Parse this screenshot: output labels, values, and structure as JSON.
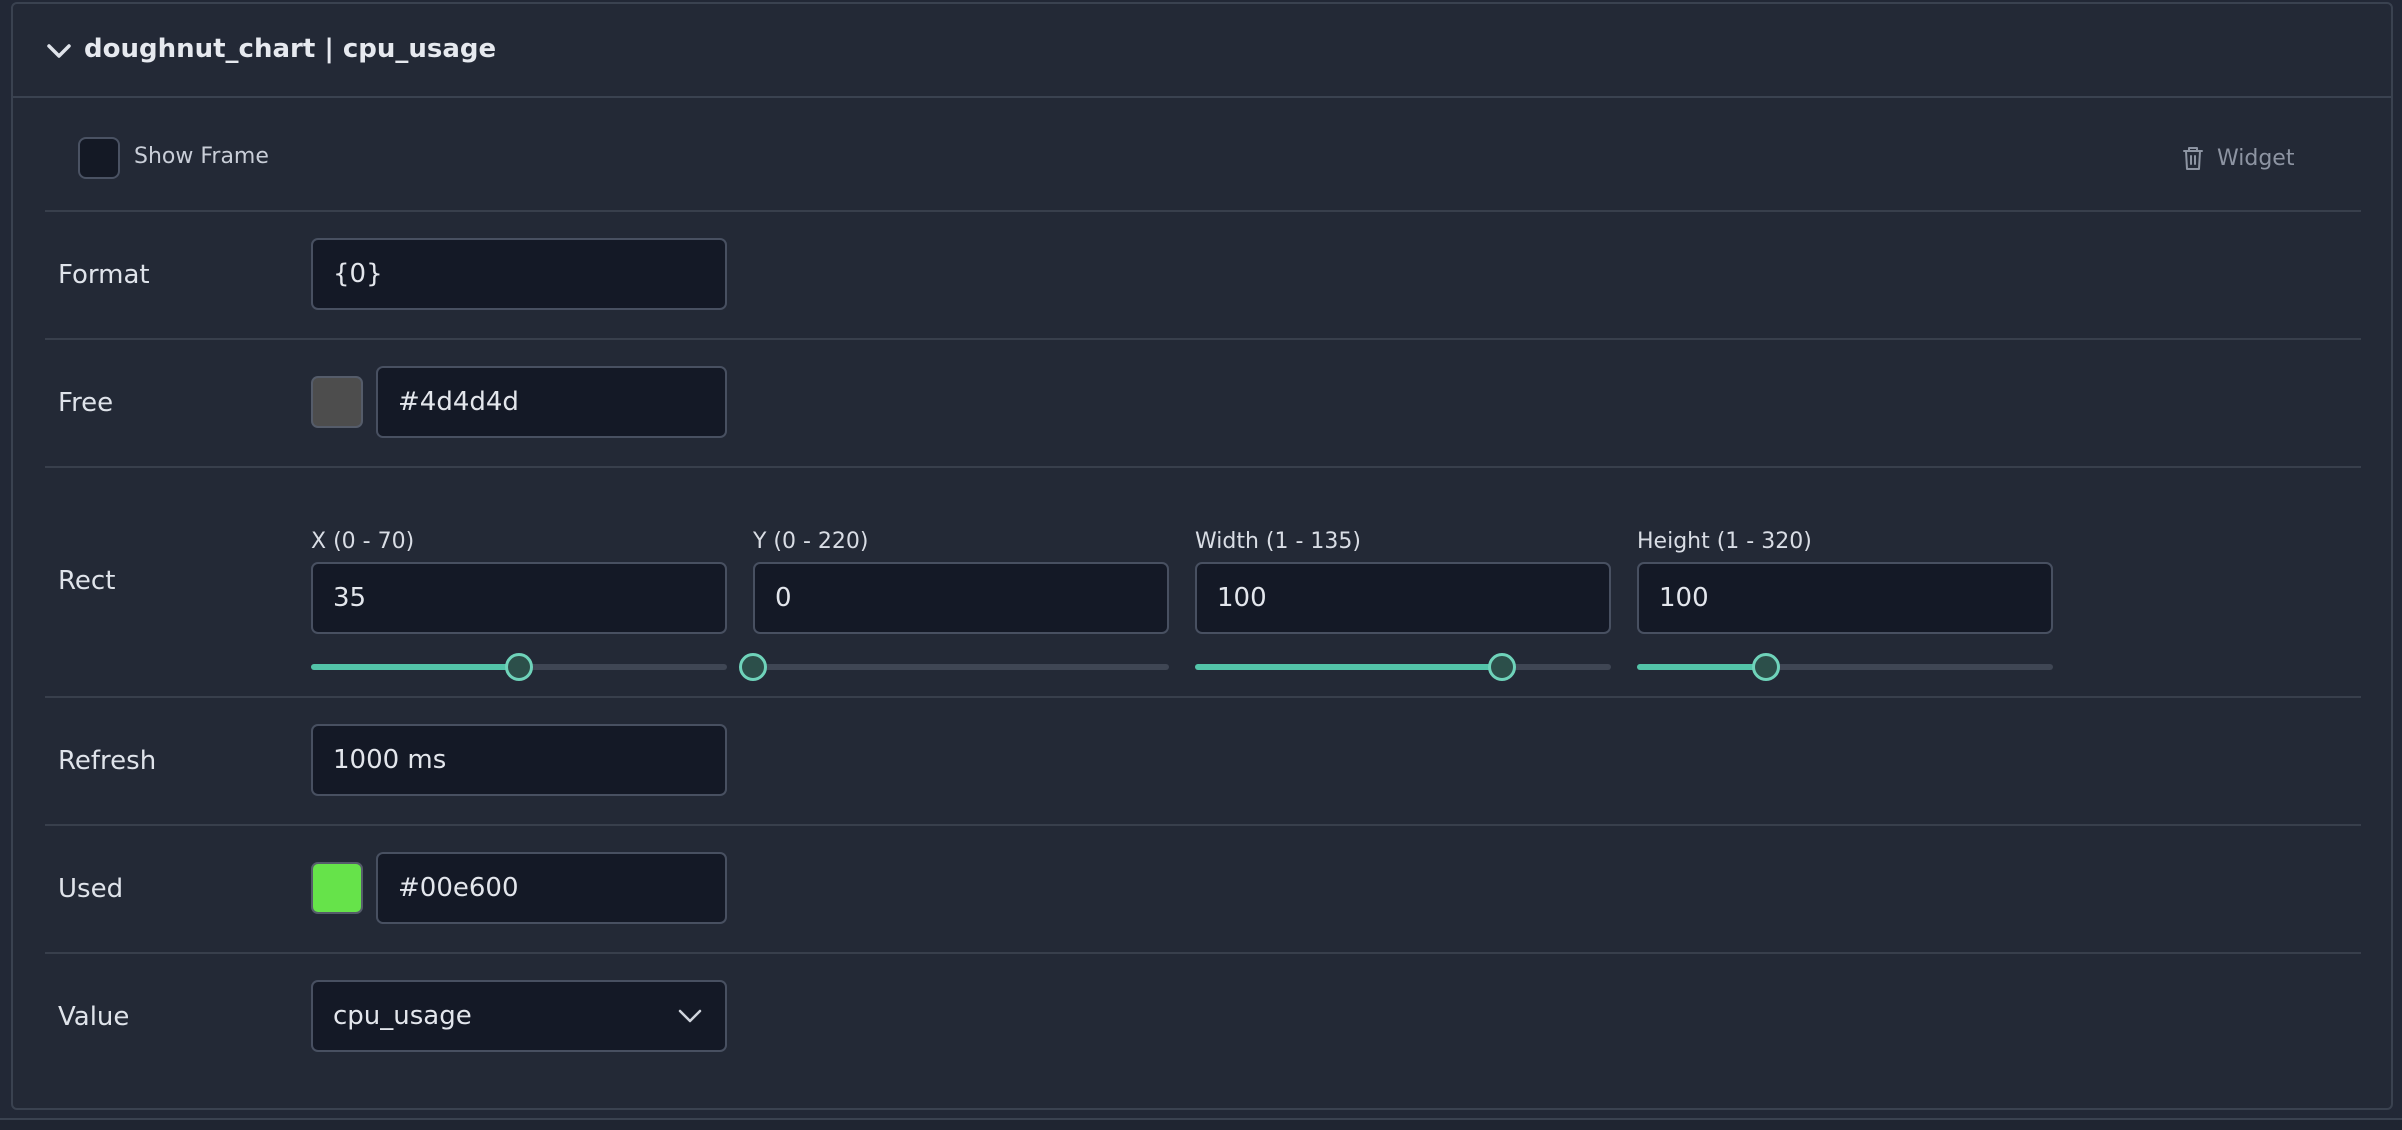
{
  "header": {
    "title": "doughnut_chart | cpu_usage"
  },
  "show_frame": {
    "label": "Show Frame",
    "checked": false
  },
  "widget_button": {
    "label": "Widget",
    "icon": "trash-icon"
  },
  "format": {
    "label": "Format",
    "value": "{0}"
  },
  "free": {
    "label": "Free",
    "color": "#4d4d4d",
    "value": "#4d4d4d"
  },
  "rect": {
    "label": "Rect",
    "x": {
      "label": "X (0 - 70)",
      "value": "35",
      "min": 0,
      "max": 70
    },
    "y": {
      "label": "Y (0 - 220)",
      "value": "0",
      "min": 0,
      "max": 220
    },
    "width": {
      "label": "Width (1 - 135)",
      "value": "100",
      "min": 1,
      "max": 135
    },
    "height": {
      "label": "Height (1 - 320)",
      "value": "100",
      "min": 1,
      "max": 320
    }
  },
  "refresh": {
    "label": "Refresh",
    "value": "1000 ms"
  },
  "used": {
    "label": "Used",
    "color": "#00e600",
    "swatch_color": "#66e34a",
    "value": "#00e600"
  },
  "value_select": {
    "label": "Value",
    "value": "cpu_usage"
  },
  "colors": {
    "accent": "#53c4a9",
    "background": "#232936",
    "field": "#141926"
  }
}
